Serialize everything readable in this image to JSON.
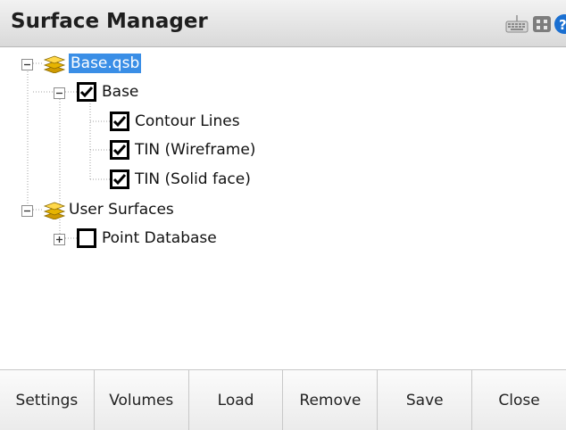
{
  "window": {
    "title": "Surface Manager"
  },
  "toolbar_icons": [
    "keyboard-icon",
    "grid-icon",
    "help-icon"
  ],
  "tree": {
    "root": {
      "label": "Base.qsb",
      "selected": true,
      "expanded": true
    },
    "base": {
      "label": "Base",
      "checked": true,
      "expanded": true
    },
    "children": [
      {
        "label": "Contour Lines",
        "checked": true
      },
      {
        "label": "TIN (Wireframe)",
        "checked": true
      },
      {
        "label": "TIN (Solid face)",
        "checked": true
      }
    ],
    "user_surfaces": {
      "label": "User Surfaces",
      "expanded": true
    },
    "point_database": {
      "label": "Point Database",
      "checked": false,
      "expanded": false
    }
  },
  "buttons": {
    "settings": "Settings",
    "volumes": "Volumes",
    "load": "Load",
    "remove": "Remove",
    "save": "Save",
    "close": "Close"
  },
  "colors": {
    "selection": "#3a8ee6",
    "layers_icon": "#e6b400",
    "help_icon": "#1a6fd1"
  }
}
